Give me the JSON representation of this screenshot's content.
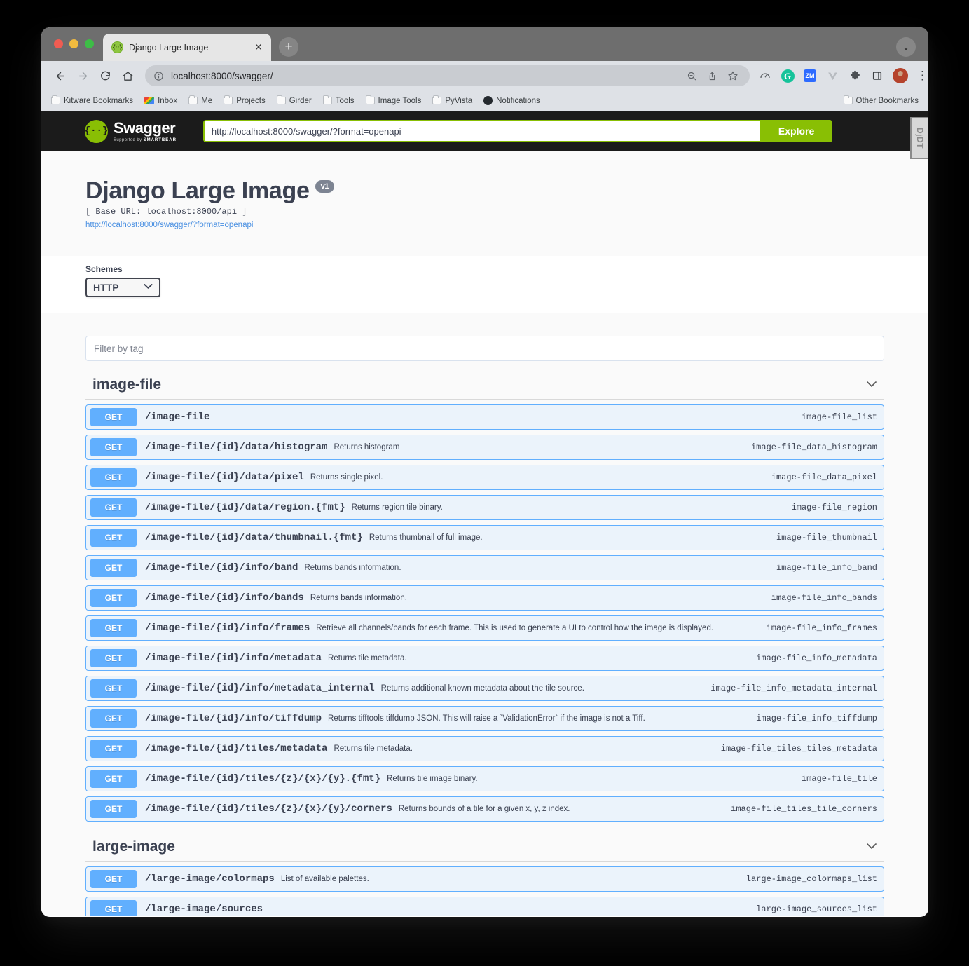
{
  "browser": {
    "tab": {
      "title": "Django Large Image",
      "favicon": "swagger-favicon",
      "close": "✕"
    },
    "newtab_label": "+",
    "window_minimize": "⌄",
    "nav": {
      "back": "←",
      "forward": "→",
      "reload": "↻",
      "home": "⌂"
    },
    "omnibox": {
      "info_icon": "ⓘ",
      "url": "localhost:8000/swagger/",
      "zoom_out_icon": "search-minus-icon",
      "share_icon": "share-icon",
      "bookmark_icon": "☆"
    },
    "extensions": [
      {
        "name": "speedometer-extension-icon",
        "glyph": "◔"
      },
      {
        "name": "grammarly-extension-icon",
        "glyph": "G"
      },
      {
        "name": "zm-extension-icon",
        "glyph": "ZM"
      },
      {
        "name": "v-extension-icon",
        "glyph": "V"
      },
      {
        "name": "puzzle-extensions-icon",
        "glyph": "❖"
      },
      {
        "name": "side-panel-icon",
        "glyph": "▣"
      }
    ],
    "profile_avatar": "user-avatar",
    "menu_icon": "⋮",
    "bookmarks": [
      {
        "label": "Kitware Bookmarks",
        "icon": "folder-icon"
      },
      {
        "label": "Inbox",
        "icon": "gmail-icon"
      },
      {
        "label": "Me",
        "icon": "folder-icon"
      },
      {
        "label": "Projects",
        "icon": "folder-icon"
      },
      {
        "label": "Girder",
        "icon": "folder-icon"
      },
      {
        "label": "Tools",
        "icon": "folder-icon"
      },
      {
        "label": "Image Tools",
        "icon": "folder-icon"
      },
      {
        "label": "PyVista",
        "icon": "folder-icon"
      },
      {
        "label": "Notifications",
        "icon": "github-icon"
      }
    ],
    "other_bookmarks": {
      "label": "Other Bookmarks",
      "icon": "folder-icon"
    }
  },
  "swagger": {
    "brand": {
      "word": "Swagger",
      "sub_prefix": "Supported by",
      "sub_brand": "SMARTBEAR",
      "mark": "{··}"
    },
    "url_value": "http://localhost:8000/swagger/?format=openapi",
    "url_placeholder": "",
    "explore_label": "Explore",
    "djdt_label": "DjDT"
  },
  "info": {
    "title": "Django Large Image",
    "version": "v1",
    "base_url": "[ Base URL: localhost:8000/api ]",
    "spec_link": "http://localhost:8000/swagger/?format=openapi"
  },
  "schemes": {
    "label": "Schemes",
    "selected": "HTTP",
    "options": [
      "HTTP"
    ],
    "chevron": "⌄"
  },
  "filter": {
    "placeholder": "Filter by tag",
    "value": ""
  },
  "sections": [
    {
      "tag": "image-file",
      "chevron": "⌄",
      "operations": [
        {
          "method": "GET",
          "path": "/image-file",
          "description": "",
          "operation_id": "image-file_list"
        },
        {
          "method": "GET",
          "path": "/image-file/{id}/data/histogram",
          "description": "Returns histogram",
          "operation_id": "image-file_data_histogram"
        },
        {
          "method": "GET",
          "path": "/image-file/{id}/data/pixel",
          "description": "Returns single pixel.",
          "operation_id": "image-file_data_pixel"
        },
        {
          "method": "GET",
          "path": "/image-file/{id}/data/region.{fmt}",
          "description": "Returns region tile binary.",
          "operation_id": "image-file_region"
        },
        {
          "method": "GET",
          "path": "/image-file/{id}/data/thumbnail.{fmt}",
          "description": "Returns thumbnail of full image.",
          "operation_id": "image-file_thumbnail"
        },
        {
          "method": "GET",
          "path": "/image-file/{id}/info/band",
          "description": "Returns bands information.",
          "operation_id": "image-file_info_band"
        },
        {
          "method": "GET",
          "path": "/image-file/{id}/info/bands",
          "description": "Returns bands information.",
          "operation_id": "image-file_info_bands"
        },
        {
          "method": "GET",
          "path": "/image-file/{id}/info/frames",
          "description": "Retrieve all channels/bands for each frame. This is used to generate a UI to control how the image is displayed.",
          "operation_id": "image-file_info_frames"
        },
        {
          "method": "GET",
          "path": "/image-file/{id}/info/metadata",
          "description": "Returns tile metadata.",
          "operation_id": "image-file_info_metadata"
        },
        {
          "method": "GET",
          "path": "/image-file/{id}/info/metadata_internal",
          "description": "Returns additional known metadata about the tile source.",
          "operation_id": "image-file_info_metadata_internal"
        },
        {
          "method": "GET",
          "path": "/image-file/{id}/info/tiffdump",
          "description": "Returns tifftools tiffdump JSON. This will raise a `ValidationError` if the image is not a Tiff.",
          "operation_id": "image-file_info_tiffdump"
        },
        {
          "method": "GET",
          "path": "/image-file/{id}/tiles/metadata",
          "description": "Returns tile metadata.",
          "operation_id": "image-file_tiles_tiles_metadata"
        },
        {
          "method": "GET",
          "path": "/image-file/{id}/tiles/{z}/{x}/{y}.{fmt}",
          "description": "Returns tile image binary.",
          "operation_id": "image-file_tile"
        },
        {
          "method": "GET",
          "path": "/image-file/{id}/tiles/{z}/{x}/{y}/corners",
          "description": "Returns bounds of a tile for a given x, y, z index.",
          "operation_id": "image-file_tiles_tile_corners"
        }
      ]
    },
    {
      "tag": "large-image",
      "chevron": "⌄",
      "operations": [
        {
          "method": "GET",
          "path": "/large-image/colormaps",
          "description": "List of available palettes.",
          "operation_id": "large-image_colormaps_list"
        },
        {
          "method": "GET",
          "path": "/large-image/sources",
          "description": "",
          "operation_id": "large-image_sources_list"
        }
      ]
    }
  ],
  "colors": {
    "get_method": "#61affe",
    "op_background": "#ebf3fb",
    "swagger_green": "#89bf04",
    "topbar_dark": "#1b1b1b",
    "text_primary": "#3b4151"
  }
}
